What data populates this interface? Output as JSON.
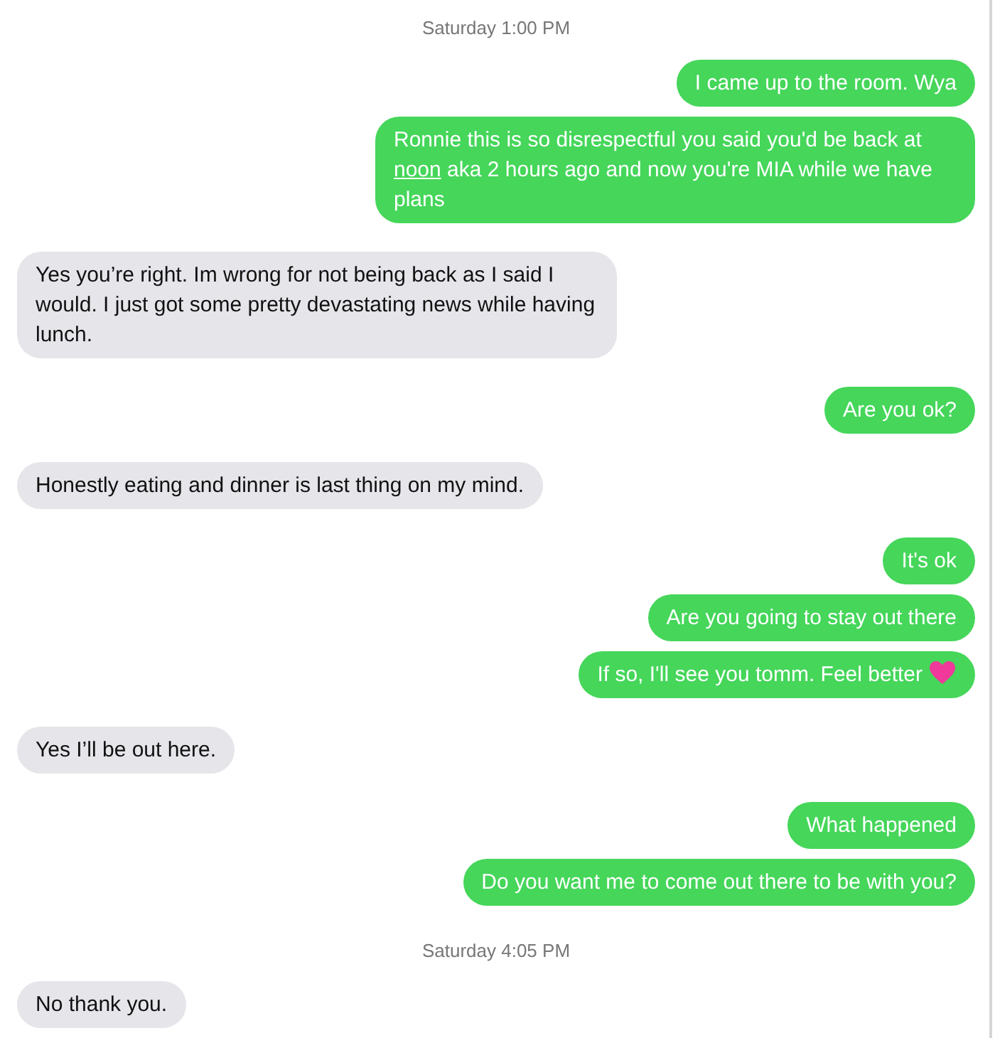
{
  "thread": [
    {
      "kind": "time",
      "text": "Saturday 1:00 PM"
    },
    {
      "kind": "sent",
      "segments": [
        {
          "text": "I came up to the room. Wya"
        }
      ]
    },
    {
      "kind": "sent",
      "segments": [
        {
          "text": "Ronnie this is so disrespectful you said you'd be back at "
        },
        {
          "text": "noon",
          "link": true
        },
        {
          "text": " aka 2 hours ago and now you're MIA while we have plans"
        }
      ]
    },
    {
      "kind": "received",
      "segments": [
        {
          "text": "Yes you’re right.  Im wrong for not being back as I said I would. I just got some pretty devastating news while having lunch."
        }
      ]
    },
    {
      "kind": "sent",
      "segments": [
        {
          "text": "Are you ok?"
        }
      ]
    },
    {
      "kind": "received",
      "segments": [
        {
          "text": "Honestly eating and dinner is last thing on my mind."
        }
      ]
    },
    {
      "kind": "sent",
      "segments": [
        {
          "text": "It's ok"
        }
      ]
    },
    {
      "kind": "sent",
      "segments": [
        {
          "text": "Are you going to stay out there"
        }
      ]
    },
    {
      "kind": "sent",
      "segments": [
        {
          "text": "If so, I'll see you tomm. Feel better"
        }
      ],
      "heart": true
    },
    {
      "kind": "received",
      "segments": [
        {
          "text": "Yes I’ll be out here."
        }
      ]
    },
    {
      "kind": "sent",
      "segments": [
        {
          "text": "What happened"
        }
      ]
    },
    {
      "kind": "sent",
      "segments": [
        {
          "text": "Do you want me to come out there to be with you?"
        }
      ]
    },
    {
      "kind": "time",
      "text": "Saturday 4:05 PM"
    },
    {
      "kind": "received",
      "segments": [
        {
          "text": "No thank you."
        }
      ]
    }
  ]
}
